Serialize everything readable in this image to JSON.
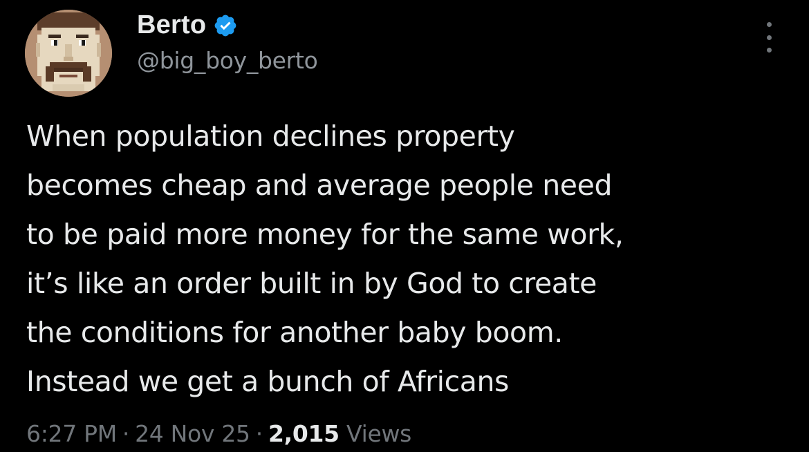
{
  "author": {
    "display_name": "Berto",
    "handle": "@big_boy_berto",
    "verified_icon": "verified-badge-icon",
    "avatar_icon": "pixel-art-mustache-face-avatar"
  },
  "menu": {
    "icon": "more-options-icon"
  },
  "tweet": {
    "lines": [
      "When population declines property",
      "becomes cheap and average people need",
      "to be paid more money for the same work,",
      "it’s like an order built in by God to create",
      "the conditions for another baby boom.",
      "Instead we get a bunch of Africans"
    ]
  },
  "meta": {
    "time": "6:27 PM",
    "separator": "·",
    "date": "24 Nov 25",
    "views_count": "2,015",
    "views_label": "Views"
  },
  "colors": {
    "background": "#000000",
    "text": "#e7e9ea",
    "secondary_text": "#71767b",
    "verified_blue": "#1d9bf0"
  }
}
